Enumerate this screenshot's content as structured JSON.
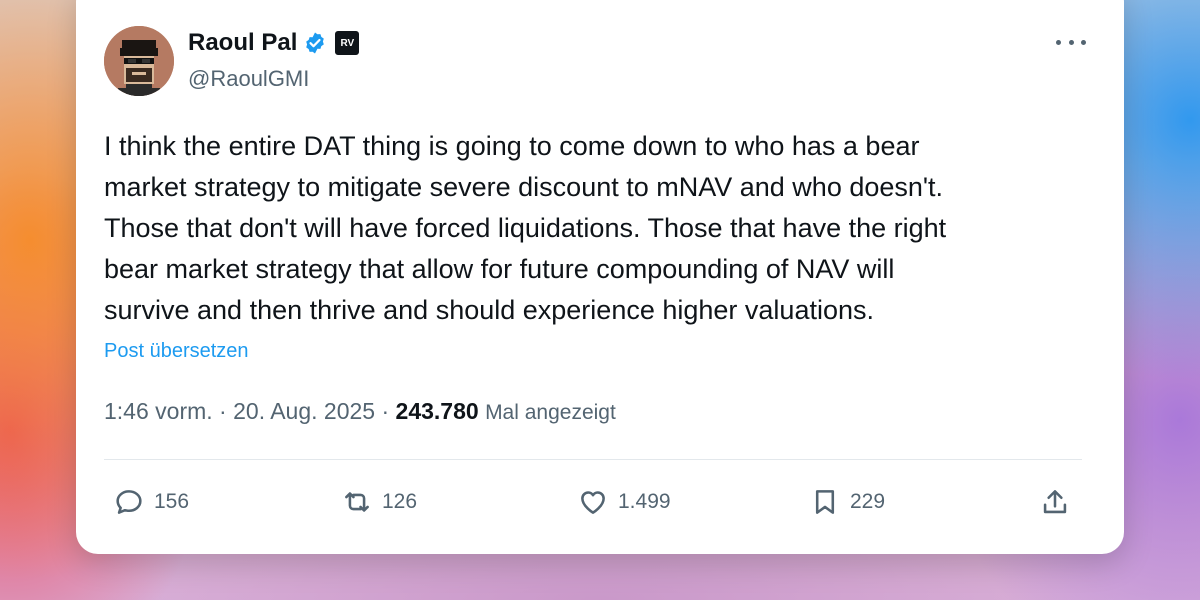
{
  "tweet": {
    "author_name": "Raoul Pal",
    "affiliate_badge": "RV",
    "handle": "@RaoulGMI",
    "lines": [
      "I think the entire DAT thing is going to come down to who has a bear",
      "market strategy to mitigate severe discount to mNAV and who doesn't.",
      "Those that don't will have forced liquidations. Those that have the right",
      "bear market strategy that allow for future compounding of NAV will",
      "survive and then thrive and should experience higher valuations."
    ],
    "translate_label": "Post übersetzen",
    "time": "1:46 vorm.",
    "date": "20. Aug. 2025",
    "views_count": "243.780",
    "views_label": "Mal angezeigt"
  },
  "actions": {
    "replies": "156",
    "reposts": "126",
    "likes": "1.499",
    "bookmarks": "229"
  },
  "icons": {
    "verified": "verified-badge-icon",
    "more": "more-dots-icon",
    "reply": "reply-icon",
    "repost": "repost-icon",
    "like": "heart-icon",
    "bookmark": "bookmark-icon",
    "share": "share-icon"
  },
  "colors": {
    "accent": "#1d9bf0",
    "text": "#0f1419",
    "muted": "#536471"
  }
}
